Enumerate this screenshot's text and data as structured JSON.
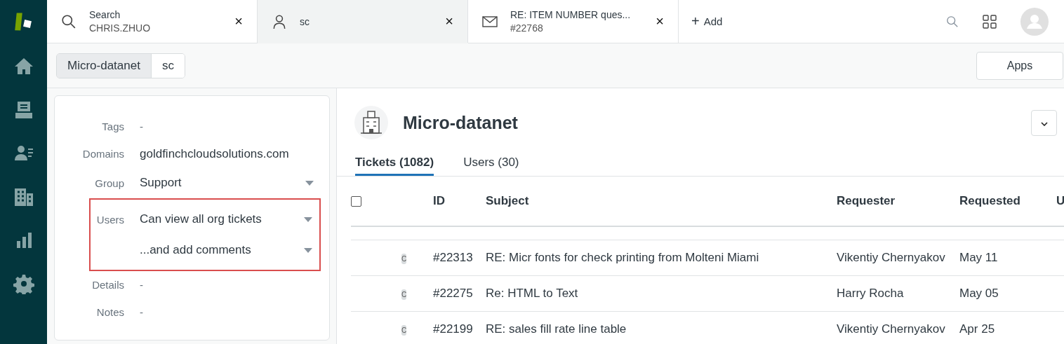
{
  "tabs": [
    {
      "kind": "search",
      "title": "Search",
      "subtitle": "CHRIS.ZHUO",
      "selected": false,
      "close": "×"
    },
    {
      "kind": "user",
      "title": "sc",
      "selected": true,
      "close": "×"
    },
    {
      "kind": "mail",
      "title": "RE: ITEM NUMBER ques...",
      "subtitle": "#22768",
      "selected": false,
      "close": "×"
    }
  ],
  "add_tab": {
    "icon": "+",
    "label": "Add"
  },
  "breadcrumbs": [
    {
      "label": "Micro-datanet",
      "selected": true
    },
    {
      "label": "sc",
      "selected": false
    }
  ],
  "apps_button": "Apps",
  "fields": [
    {
      "label": "Tags",
      "value": "-",
      "kind": "text"
    },
    {
      "label": "Domains",
      "value": "goldfinchcloudsolutions.com",
      "kind": "text"
    },
    {
      "label": "Group",
      "value": "Support",
      "kind": "dropdown"
    },
    {
      "label": "Users",
      "value": "Can view all org tickets",
      "kind": "dropdown",
      "highlighted": true
    },
    {
      "value": "...and add comments",
      "kind": "dropdown",
      "highlighted": true
    },
    {
      "label": "Details",
      "value": "-",
      "kind": "text"
    },
    {
      "label": "Notes",
      "value": "-",
      "kind": "text"
    }
  ],
  "org": {
    "name": "Micro-datanet"
  },
  "org_tabs": [
    {
      "label": "Tickets (1082)",
      "selected": true
    },
    {
      "label": "Users (30)",
      "selected": false
    }
  ],
  "table": {
    "select_all": {
      "checked": false
    },
    "columns": [
      "ID",
      "Subject",
      "Requester",
      "Requested",
      "U"
    ],
    "rows": [
      {
        "badge": "C",
        "id": "#22313",
        "subject": "RE: Micr fonts for check printing from Molteni Miami",
        "requester": "Vikentiy Chernyakov",
        "requested": "May 11"
      },
      {
        "badge": "C",
        "id": "#22275",
        "subject": "Re: HTML to Text",
        "requester": "Harry Rocha",
        "requested": "May 05"
      },
      {
        "badge": "C",
        "id": "#22199",
        "subject": "RE: sales fill rate line table",
        "requester": "Vikentiy Chernyakov",
        "requested": "Apr 25"
      }
    ]
  }
}
